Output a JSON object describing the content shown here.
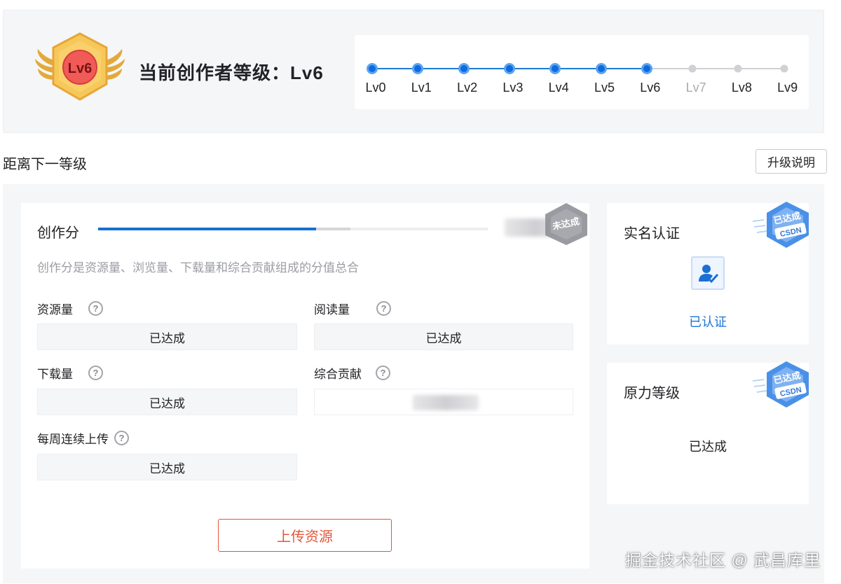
{
  "header": {
    "badge_text": "Lv6",
    "title": "当前创作者等级：Lv6",
    "levels": [
      {
        "label": "Lv0",
        "reached": true
      },
      {
        "label": "Lv1",
        "reached": true
      },
      {
        "label": "Lv2",
        "reached": true
      },
      {
        "label": "Lv3",
        "reached": true
      },
      {
        "label": "Lv4",
        "reached": true
      },
      {
        "label": "Lv5",
        "reached": true
      },
      {
        "label": "Lv6",
        "reached": true
      },
      {
        "label": "Lv7",
        "reached": false
      },
      {
        "label": "Lv8",
        "reached": false
      },
      {
        "label": "Lv9",
        "reached": false
      }
    ]
  },
  "section": {
    "title": "距离下一等级",
    "upgrade_button": "升级说明"
  },
  "score": {
    "title": "创作分",
    "progress": 0.56,
    "description": "创作分是资源量、浏览量、下载量和综合贡献组成的分值总合",
    "metrics": {
      "resources": {
        "label": "资源量",
        "status": "已达成"
      },
      "reads": {
        "label": "阅读量",
        "status": "已达成"
      },
      "downloads": {
        "label": "下载量",
        "status": "已达成"
      },
      "contribution": {
        "label": "综合贡献"
      },
      "weekly_upload": {
        "label": "每周连续上传",
        "status": "已达成"
      }
    },
    "stamp_text": "未达成",
    "upload_button": "上传资源"
  },
  "real_name": {
    "title": "实名认证",
    "status": "已认证",
    "stamp_text": "已达成",
    "stamp_brand": "CSDN"
  },
  "power_level": {
    "title": "原力等级",
    "status": "已达成",
    "stamp_text": "已达成",
    "stamp_brand": "CSDN"
  },
  "watermark": "掘金技术社区 @ 武昌库里",
  "colors": {
    "accent": "#1470d1",
    "upload": "#e35639",
    "badge_gold": "#f3b84a",
    "badge_red": "#f05a57"
  }
}
